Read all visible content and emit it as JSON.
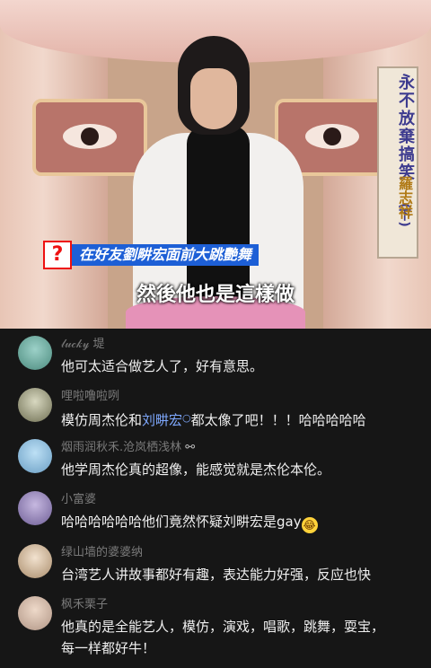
{
  "video": {
    "show_title": "永不放棄搞笑",
    "episode": "(下)",
    "guest": "羅志祥",
    "caption": "在好友劉畊宏面前大跳艷舞",
    "subtitle": "然後他也是這樣做",
    "question_icon": "?"
  },
  "comments": [
    {
      "user": "𝓁𝓊𝒸𝓀𝓎 堤",
      "text": "他可太适合做艺人了，好有意思。"
    },
    {
      "user": "哩啦噜啦咧",
      "text_before": "模仿周杰伦和",
      "link": "刘畊宏",
      "text_after": "都太像了吧！！！哈哈哈哈哈"
    },
    {
      "user": "烟雨润秋禾.沧岚栖浅林",
      "text": "他学周杰伦真的超像，能感觉就是杰伦本伦。"
    },
    {
      "user": "小富婆",
      "text": "哈哈哈哈哈哈他们竟然怀疑刘畊宏是gay"
    },
    {
      "user": "绿山墙的婆婆纳",
      "text": "台湾艺人讲故事都好有趣，表达能力好强，反应也快"
    },
    {
      "user": "枫禾栗子",
      "text": "他真的是全能艺人，模仿，演戏，唱歌，跳舞，耍宝，",
      "text2": "每一样都好牛！"
    }
  ],
  "colors": {
    "accent": "#7fa9ff",
    "background": "#161616",
    "caption_bar": "#1d5fd6"
  }
}
